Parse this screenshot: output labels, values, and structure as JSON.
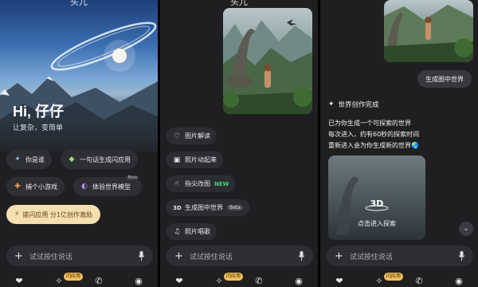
{
  "panel1": {
    "top_title": "头兀",
    "greeting": "Hi, 仔仔",
    "subtitle": "让复杂，变简单",
    "chips": [
      {
        "icon": "sparkle-icon",
        "label": "你是谁"
      },
      {
        "icon": "flash-app-icon",
        "label": "一句话生成闪应用"
      },
      {
        "icon": "game-icon",
        "label": "捕个小游戏"
      },
      {
        "icon": "world-model-icon",
        "label": "体验世界模型",
        "badge": "Beta"
      }
    ],
    "promo": "搓闪应用 分1亿创作激励",
    "input_placeholder": "试试按住说话"
  },
  "panel2": {
    "top_title": "头兀",
    "options": [
      {
        "icon": "image-read-icon",
        "label": "图片解读"
      },
      {
        "icon": "image-animate-icon",
        "label": "照片动起来"
      },
      {
        "icon": "finger-edit-icon",
        "label": "指尖改图",
        "tag": "NEW"
      },
      {
        "icon": "3d-icon",
        "label": "生成图中世界",
        "badge": "Beta"
      },
      {
        "icon": "music-icon",
        "label": "照片唱歌"
      }
    ],
    "input_placeholder": "试试按住说话"
  },
  "panel3": {
    "user_bubble": "生成图中世界",
    "done_title": "世界创作完成",
    "desc_lines": [
      "已为你生成一个可探索的世界",
      "每次进入，约有60秒的探索时间",
      "重新进入会为你生成新的世界🌏"
    ],
    "card_label": "3D",
    "card_caption": "点击进入探索",
    "input_placeholder": "试试按住说话"
  },
  "tabbar": {
    "badge": "闪应用"
  },
  "colors": {
    "panel_bg": "#1f1f21",
    "chip_bg": "#2e2f33",
    "promo_bg": "#f3dfb0",
    "new_tag": "#49d17b",
    "badge": "#f3c05a"
  }
}
